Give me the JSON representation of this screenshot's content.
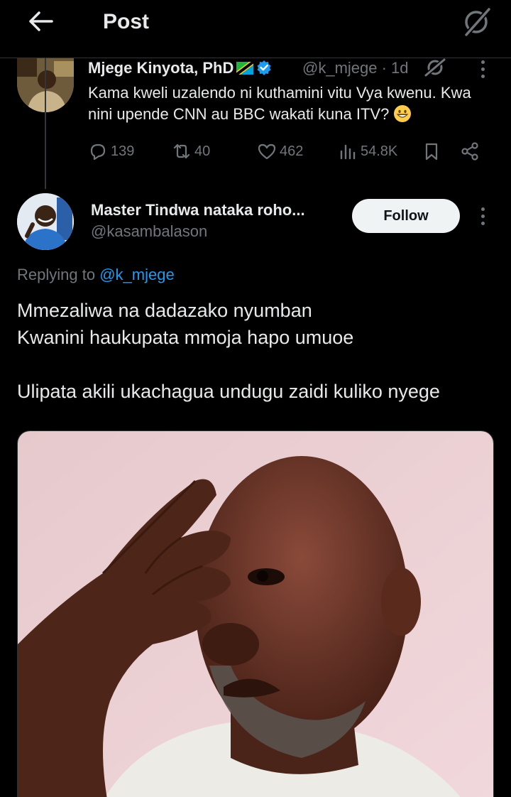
{
  "header": {
    "title": "Post",
    "back_icon": "arrow-left-icon",
    "grok_icon": "grok-icon"
  },
  "parent_tweet": {
    "author_name": "Mjege Kinyota, PhD",
    "handle_time": "@k_mjege · 1d",
    "text": "Kama kweli uzalendo ni kuthamini vitu Vya kwenu. Kwa nini upende CNN au BBC wakati kuna ITV?",
    "emoji": "grinning-face-emoji",
    "stats": {
      "replies": "139",
      "reposts": "40",
      "likes": "462",
      "views": "54.8K"
    }
  },
  "reply_tweet": {
    "author_name": "Master Tindwa nataka roho...",
    "handle": "@kasambalason",
    "follow_label": "Follow",
    "replying_prefix": "Replying to",
    "replying_to": "@k_mjege",
    "lines": [
      "Mmezaliwa na dadazako nyumban",
      "Kwanini haukupata mmoja hapo umuoe",
      "Ulipata akili ukachagua undugu zaidi kuliko nyege"
    ]
  },
  "colors": {
    "background": "#000000",
    "text": "#e7e9ea",
    "muted": "#71767b",
    "accent": "#1d9bf0",
    "verified": "#1d9bf0"
  }
}
